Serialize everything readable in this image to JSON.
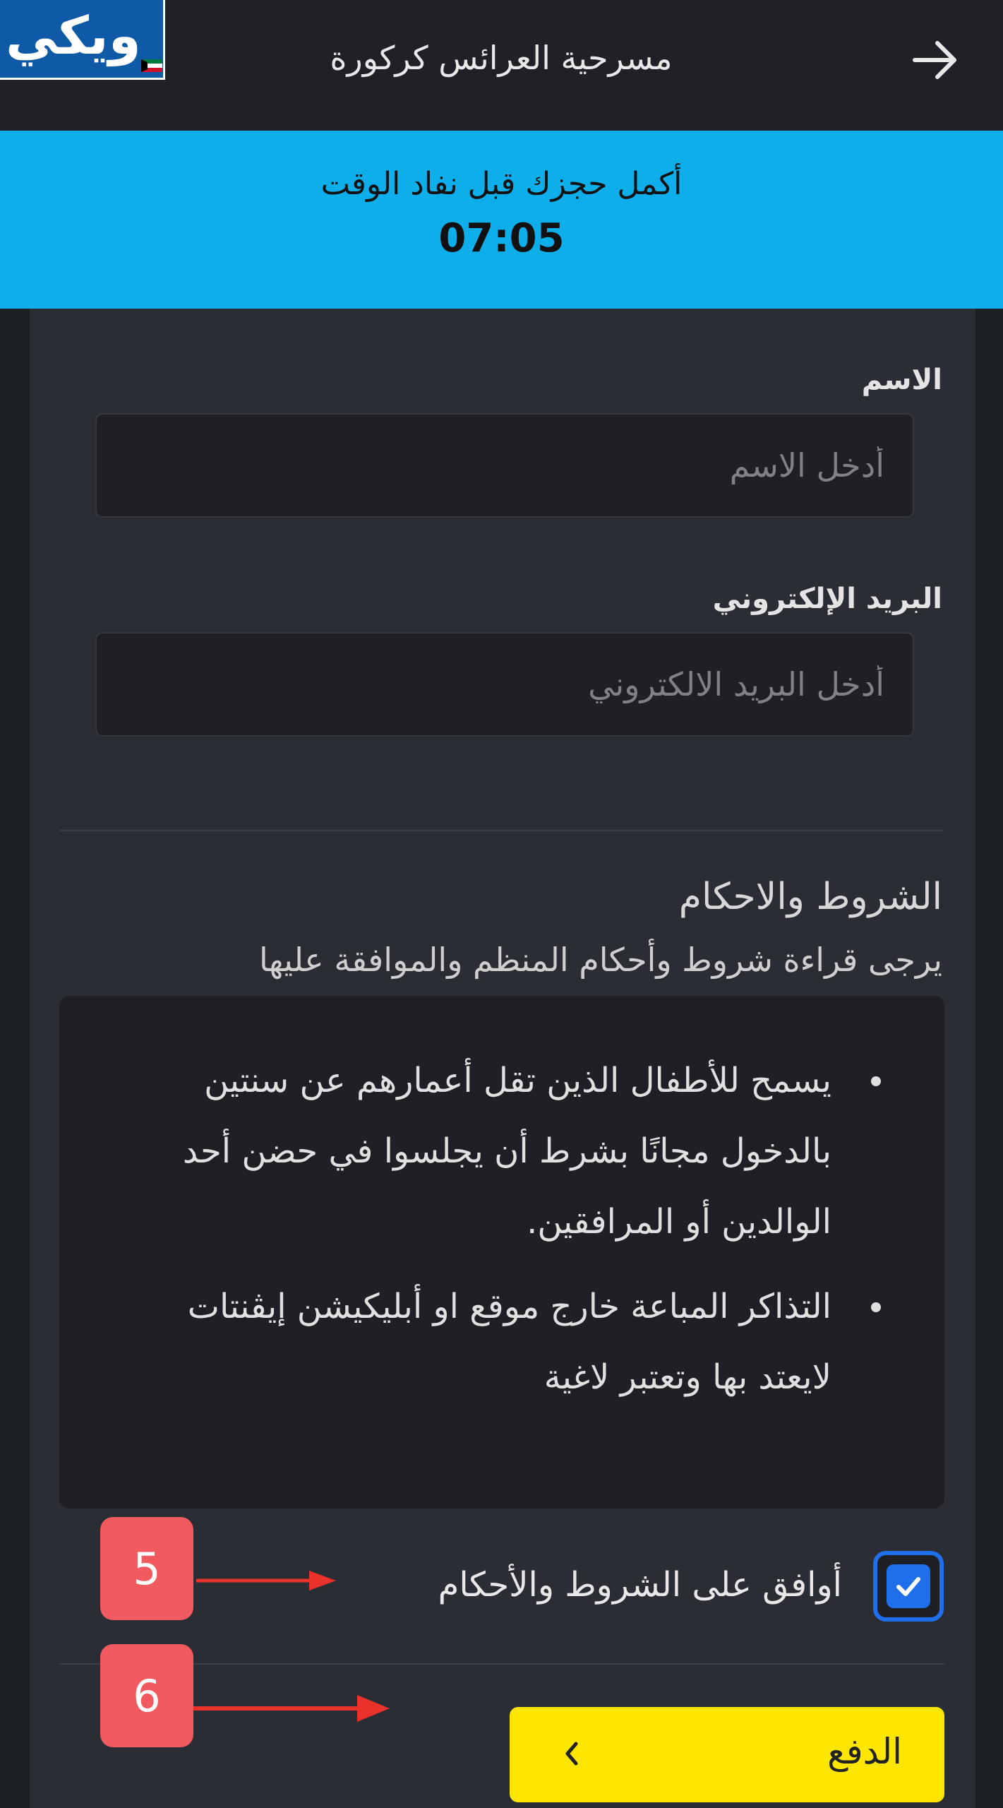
{
  "header": {
    "title": "مسرحية العرائس كركورة",
    "back_icon": "arrow-right-icon",
    "logo_text": "ويكي"
  },
  "timer": {
    "label": "أكمل حجزك قبل نفاد الوقت",
    "value": "07:05"
  },
  "form": {
    "name_label": "الاسم",
    "name_placeholder": "أدخل الاسم",
    "email_label": "البريد الإلكتروني",
    "email_placeholder": "أدخل البريد الالكتروني"
  },
  "terms": {
    "title": "الشروط والاحكام",
    "subtitle": "يرجى قراءة شروط وأحكام المنظم والموافقة عليها",
    "items": [
      "يسمح للأطفال الذين تقل أعمارهم عن سنتين بالدخول مجانًا بشرط أن يجلسوا في حضن أحد الوالدين أو المرافقين.",
      "التذاكر المباعة خارج موقع او أبليكيشن إيڤنتات لايعتد بها وتعتبر لاغية"
    ]
  },
  "agree": {
    "label": "أوافق على الشروط والأحكام",
    "checked": true
  },
  "pay": {
    "label": "الدفع",
    "icon": "chevron-left-icon"
  },
  "annotations": {
    "step5": "5",
    "step6": "6"
  },
  "colors": {
    "banner": "#0daeea",
    "pay_button": "#ffe600",
    "checkbox": "#1f6feb",
    "annotation": "#f15a5f"
  }
}
